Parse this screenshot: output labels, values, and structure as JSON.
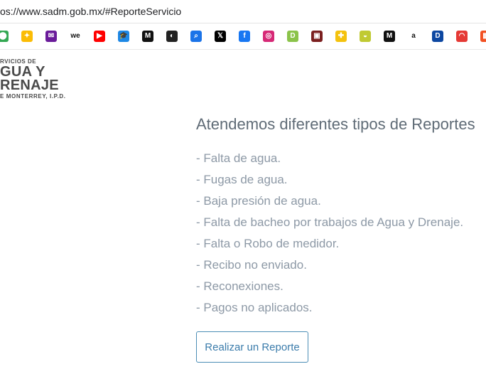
{
  "browser": {
    "url": "os://www.sadm.gob.mx/#ReporteServicio"
  },
  "bookmarks": [
    {
      "icon": "maps-pin-icon",
      "color": "#34a853",
      "glyph": "⬤"
    },
    {
      "icon": "pinwheel-icon",
      "color": "#fbbc05",
      "glyph": "✦"
    },
    {
      "icon": "mail-icon",
      "color": "#6a1b9a",
      "glyph": "✉"
    },
    {
      "icon": "we-logo-icon",
      "color": "#ffffff",
      "glyph": "we"
    },
    {
      "icon": "youtube-icon",
      "color": "#ff0000",
      "glyph": "▶"
    },
    {
      "icon": "graduation-cap-icon",
      "color": "#1e88e5",
      "glyph": "🎓"
    },
    {
      "icon": "m-logo-icon",
      "color": "#111111",
      "glyph": "M"
    },
    {
      "icon": "circle-bars-icon",
      "color": "#222222",
      "glyph": "◐"
    },
    {
      "icon": "search-icon",
      "color": "#1a73e8",
      "glyph": "⌕"
    },
    {
      "icon": "x-icon",
      "color": "#000000",
      "glyph": "𝕏"
    },
    {
      "icon": "facebook-icon",
      "color": "#1877f2",
      "glyph": "f"
    },
    {
      "icon": "instagram-icon",
      "color": "#d62976",
      "glyph": "◎"
    },
    {
      "icon": "d-logo-icon",
      "color": "#8bc34a",
      "glyph": "D"
    },
    {
      "icon": "movie-poster-icon",
      "color": "#7b1f1f",
      "glyph": "▣"
    },
    {
      "icon": "yellow-app-icon",
      "color": "#f4c20d",
      "glyph": "✚"
    },
    {
      "icon": "green-bowl-icon",
      "color": "#c0ca33",
      "glyph": "◒"
    },
    {
      "icon": "m-logo-2-icon",
      "color": "#111111",
      "glyph": "M"
    },
    {
      "icon": "amazon-icon",
      "color": "#ffffff",
      "glyph": "a"
    },
    {
      "icon": "d-square-icon",
      "color": "#0d47a1",
      "glyph": "D"
    },
    {
      "icon": "speed-arc-icon",
      "color": "#e53935",
      "glyph": "◠"
    },
    {
      "icon": "windows-grid-icon",
      "color": "#f25022",
      "glyph": "▦"
    }
  ],
  "logo": {
    "line1": "RVICIOS DE",
    "line2": "GUA Y",
    "line3": "RENAJE",
    "line4": "E MONTERREY, I.P.D."
  },
  "main": {
    "heading": "Atendemos diferentes tipos de Reportes",
    "items": [
      "- Falta de agua.",
      "- Fugas de agua.",
      "- Baja presión de agua.",
      "- Falta de bacheo por trabajos de Agua y Drenaje.",
      "- Falta o Robo de medidor.",
      "- Recibo no enviado.",
      "- Reconexiones.",
      "- Pagos no aplicados."
    ],
    "button_label": "Realizar un Reporte"
  }
}
